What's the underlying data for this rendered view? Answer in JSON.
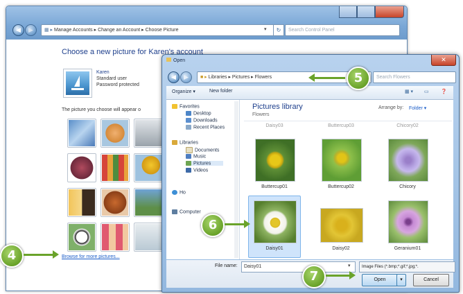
{
  "back_window": {
    "breadcrumb": [
      "Manage Accounts",
      "Change an Account",
      "Choose Picture"
    ],
    "search_placeholder": "Search Control Panel",
    "heading": "Choose a new picture for Karen's account",
    "account": {
      "name": "Karen",
      "type": "Standard user",
      "status": "Password protected"
    },
    "info_text": "The picture you choose will appear o",
    "browse_link": "Browse for more pictures..."
  },
  "open_dialog": {
    "title": "Open",
    "breadcrumb": [
      "Libraries",
      "Pictures",
      "Flowers"
    ],
    "search_placeholder": "Search Flowers",
    "toolbar": {
      "organize": "Organize ▾",
      "new_folder": "New folder"
    },
    "nav": {
      "favorites_header": "Favorites",
      "favorites": [
        "Desktop",
        "Downloads",
        "Recent Places"
      ],
      "libraries_header": "Libraries",
      "libraries": [
        "Documents",
        "Music",
        "Pictures",
        "Videos"
      ],
      "homegroup": "Ho",
      "computer": "Computer"
    },
    "library": {
      "title": "Pictures library",
      "subtitle": "Flowers",
      "arrange_label": "Arrange by:",
      "arrange_value": "Folder ▾"
    },
    "top_partial_labels": [
      "Daisy03",
      "Buttercup03",
      "Chicory02"
    ],
    "thumbnails": [
      {
        "label": "Buttercup01"
      },
      {
        "label": "Buttercup02"
      },
      {
        "label": "Chicory"
      },
      {
        "label": "Daisy01"
      },
      {
        "label": "Daisy02"
      },
      {
        "label": "Geranium01"
      }
    ],
    "file_name_label": "File name:",
    "file_name_value": "Daisy01",
    "file_type": "Image Files (*.bmp;*.gif;*.jpg;*.",
    "open_button": "Open",
    "cancel_button": "Cancel"
  },
  "callouts": [
    "4",
    "5",
    "6",
    "7"
  ]
}
